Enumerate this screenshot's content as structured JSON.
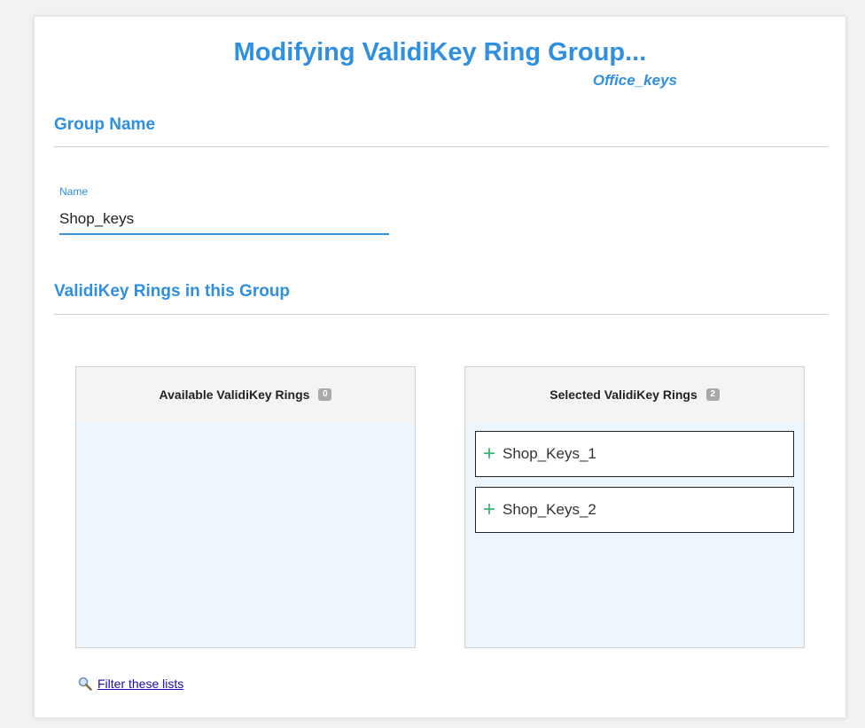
{
  "header": {
    "title": "Modifying ValidiKey Ring Group...",
    "subtitle": "Office_keys"
  },
  "group_name_section": {
    "heading": "Group Name",
    "name_label": "Name",
    "name_value": "Shop_keys"
  },
  "rings_section": {
    "heading": "ValidiKey Rings in this Group",
    "available": {
      "title": "Available ValidiKey Rings",
      "count": "0",
      "items": []
    },
    "selected": {
      "title": "Selected ValidiKey Rings",
      "count": "2",
      "items": [
        {
          "icon": "plus-icon",
          "label": "Shop_Keys_1"
        },
        {
          "icon": "plus-icon",
          "label": "Shop_Keys_2"
        }
      ]
    }
  },
  "filter": {
    "icon": "magnifier-icon",
    "label": "Filter these lists"
  },
  "colors": {
    "accent": "#2f8fe0",
    "list_background": "#eef6fd",
    "plus_green": "#3cb371",
    "badge_gray": "#a9a9a9",
    "link": "#1a0dab"
  }
}
